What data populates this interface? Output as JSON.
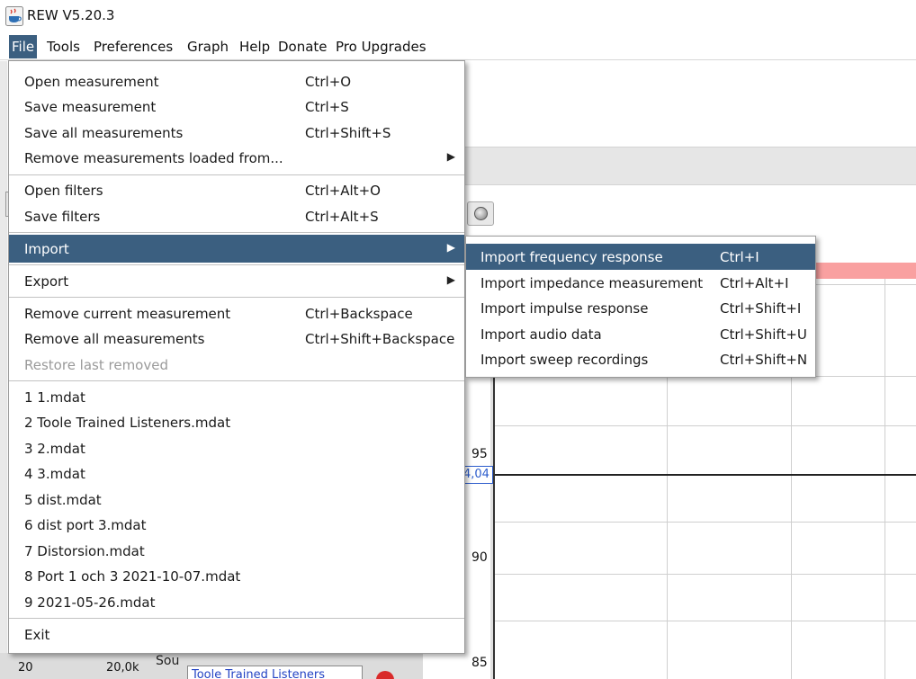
{
  "window": {
    "title": "REW V5.20.3"
  },
  "menubar": [
    {
      "label": "File",
      "active": true
    },
    {
      "label": "Tools"
    },
    {
      "label": "Preferences"
    },
    {
      "label": "Graph"
    },
    {
      "label": "Help"
    },
    {
      "label": "Donate"
    },
    {
      "label": "Pro Upgrades"
    }
  ],
  "file_menu": {
    "items": [
      {
        "label": "Open measurement",
        "shortcut": "Ctrl+O"
      },
      {
        "label": "Save measurement",
        "shortcut": "Ctrl+S"
      },
      {
        "label": "Save all measurements",
        "shortcut": "Ctrl+Shift+S"
      },
      {
        "label": "Remove measurements loaded from...",
        "shortcut": ""
      },
      {
        "label": "Open filters",
        "shortcut": "Ctrl+Alt+O"
      },
      {
        "label": "Save filters",
        "shortcut": "Ctrl+Alt+S"
      },
      {
        "label": "Import",
        "shortcut": ""
      },
      {
        "label": "Export",
        "shortcut": ""
      },
      {
        "label": "Remove current measurement",
        "shortcut": "Ctrl+Backspace"
      },
      {
        "label": "Remove all measurements",
        "shortcut": "Ctrl+Shift+Backspace"
      },
      {
        "label": "Restore last removed",
        "shortcut": ""
      },
      {
        "label": "1 1.mdat",
        "shortcut": ""
      },
      {
        "label": "2 Toole Trained Listeners.mdat",
        "shortcut": ""
      },
      {
        "label": "3 2.mdat",
        "shortcut": ""
      },
      {
        "label": "4 3.mdat",
        "shortcut": ""
      },
      {
        "label": "5 dist.mdat",
        "shortcut": ""
      },
      {
        "label": "6 dist port 3.mdat",
        "shortcut": ""
      },
      {
        "label": "7 Distorsion.mdat",
        "shortcut": ""
      },
      {
        "label": "8 Port 1 och 3 2021-10-07.mdat",
        "shortcut": ""
      },
      {
        "label": "9 2021-05-26.mdat",
        "shortcut": ""
      },
      {
        "label": "Exit",
        "shortcut": ""
      }
    ]
  },
  "import_submenu": {
    "items": [
      {
        "label": "Import frequency response",
        "shortcut": "Ctrl+I"
      },
      {
        "label": "Import impedance measurement",
        "shortcut": "Ctrl+Alt+I"
      },
      {
        "label": "Import impulse response",
        "shortcut": "Ctrl+Shift+I"
      },
      {
        "label": "Import audio data",
        "shortcut": "Ctrl+Shift+U"
      },
      {
        "label": "Import sweep recordings",
        "shortcut": "Ctrl+Shift+N"
      }
    ]
  },
  "graph": {
    "y_ticks": [
      "95",
      "90",
      "85"
    ],
    "cursor_value": "4,04",
    "x_axis_left": "20",
    "x_axis_right": "20,0k",
    "source_label": "Sou",
    "measurement_field": "Toole Trained Listeners"
  },
  "colors": {
    "menu_highlight": "#3b5f80",
    "cursor_blue": "#2c5ccc",
    "plot_band": "#f9a0a0"
  }
}
